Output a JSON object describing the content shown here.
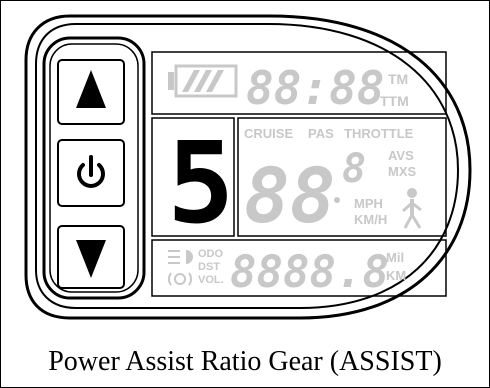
{
  "display": {
    "time_digits": "88:88",
    "time_units": [
      "TM",
      "TTM"
    ],
    "assist_level": "5",
    "mode_labels": [
      "CRUISE",
      "PAS",
      "THROTTLE"
    ],
    "speed_digits": "88",
    "speed_decimal": "8",
    "avs_labels": [
      "AVS",
      "MXS"
    ],
    "speed_units": [
      "MPH",
      "KM/H"
    ],
    "trip_labels": [
      "ODO",
      "DST",
      "VOL."
    ],
    "trip_digits": "8888.8",
    "distance_units": [
      "Mil",
      "KM"
    ]
  },
  "buttons": {
    "up": "up-arrow-icon",
    "power": "power-icon",
    "down": "down-arrow-icon"
  },
  "caption": "Power Assist Ratio Gear (ASSIST)"
}
